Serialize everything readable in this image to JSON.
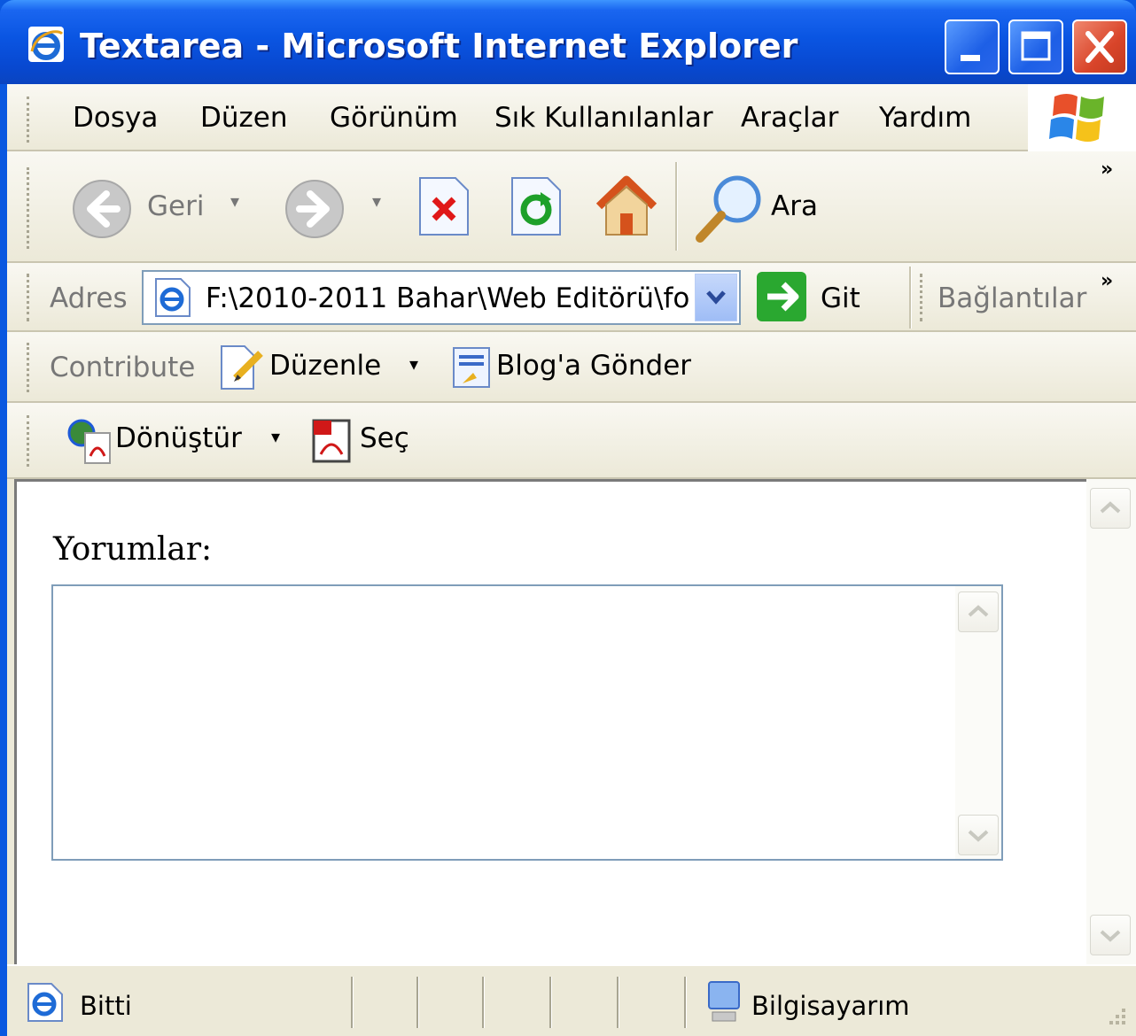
{
  "window": {
    "title": "Textarea - Microsoft Internet Explorer",
    "minimize_icon": "minimize-icon",
    "maximize_icon": "maximize-icon",
    "close_icon": "close-icon"
  },
  "menubar": {
    "items": [
      "Dosya",
      "Düzen",
      "Görünüm",
      "Sık Kullanılanlar",
      "Araçlar",
      "Yardım"
    ]
  },
  "toolbar": {
    "back_label": "Geri",
    "search_label": "Ara",
    "more": "»"
  },
  "addressbar": {
    "label": "Adres",
    "value": "F:\\2010-2011 Bahar\\Web Editörü\\fo",
    "go_label": "Git",
    "links_label": "Bağlantılar",
    "more": "»"
  },
  "contribute_bar": {
    "label": "Contribute",
    "edit_label": "Düzenle",
    "blog_label": "Blog'a Gönder"
  },
  "pdf_bar": {
    "convert_label": "Dönüştür",
    "select_label": "Seç"
  },
  "page": {
    "label": "Yorumlar:",
    "textarea_value": ""
  },
  "statusbar": {
    "status_text": "Bitti",
    "zone_text": "Bilgisayarım"
  },
  "colors": {
    "titlebar": "#0a55e2",
    "frame": "#ece9d8",
    "input_border": "#7f9db9"
  }
}
